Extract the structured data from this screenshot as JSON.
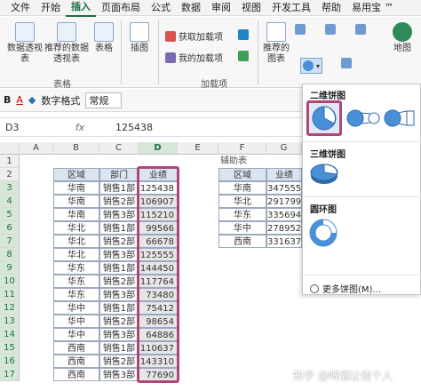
{
  "menubar": {
    "items": [
      "文件",
      "开始",
      "插入",
      "页面布局",
      "公式",
      "数据",
      "审阅",
      "视图",
      "开发工具",
      "帮助",
      "易用宝 ™"
    ],
    "active_index": 2
  },
  "ribbon": {
    "pivot_table_label": "数据透视表",
    "recommended_pivot_label": "推荐的数据透视表",
    "table_label": "表格",
    "group_tables_label": "表格",
    "illustrations_label": "插图",
    "get_addins_label": "获取加载项",
    "my_addins_label": "我的加载项",
    "group_addins_label": "加载项",
    "recommended_charts_label": "推荐的图表",
    "map_label": "地图"
  },
  "format_toolbar": {
    "number_format_label": "数字格式",
    "number_format_value": "常规"
  },
  "formula_bar": {
    "name_box": "D3",
    "fx": "fx",
    "value": "125438"
  },
  "sheet": {
    "columns": [
      "A",
      "B",
      "C",
      "D",
      "E",
      "F",
      "G"
    ],
    "selected_column": "D",
    "rows": [
      "1",
      "2",
      "3",
      "4",
      "5",
      "6",
      "7",
      "8",
      "9",
      "10",
      "11",
      "12",
      "13",
      "14",
      "15",
      "16",
      "17"
    ],
    "main_headers": [
      "区域",
      "部门",
      "业绩"
    ],
    "main_rows": [
      [
        "华南",
        "销售1部",
        "125438"
      ],
      [
        "华南",
        "销售2部",
        "106907"
      ],
      [
        "华南",
        "销售3部",
        "115210"
      ],
      [
        "华北",
        "销售1部",
        "99566"
      ],
      [
        "华北",
        "销售2部",
        "66678"
      ],
      [
        "华北",
        "销售3部",
        "125555"
      ],
      [
        "华东",
        "销售1部",
        "144450"
      ],
      [
        "华东",
        "销售2部",
        "117764"
      ],
      [
        "华东",
        "销售3部",
        "73480"
      ],
      [
        "华中",
        "销售1部",
        "75412"
      ],
      [
        "华中",
        "销售2部",
        "98654"
      ],
      [
        "华中",
        "销售3部",
        "64886"
      ],
      [
        "西南",
        "销售1部",
        "110637"
      ],
      [
        "西南",
        "销售2部",
        "143310"
      ],
      [
        "西南",
        "销售3部",
        "77690"
      ]
    ],
    "aux_title": "辅助表",
    "aux_headers": [
      "区域",
      "业绩"
    ],
    "aux_rows": [
      [
        "华南",
        "347555"
      ],
      [
        "华北",
        "291799"
      ],
      [
        "华东",
        "335694"
      ],
      [
        "华中",
        "278952"
      ],
      [
        "西南",
        "331637"
      ]
    ]
  },
  "pie_dropdown": {
    "section_2d": "二维饼图",
    "section_3d": "三维饼图",
    "section_donut": "圆环图",
    "more_label": "更多饼图(M)..."
  },
  "watermark": "知乎 @啤酒让他个人",
  "colors": {
    "accent_green": "#1e7145",
    "selection_magenta": "#b0457a",
    "table_header_fill": "#dbe5f1",
    "chart_blue": "#4a90d9"
  }
}
